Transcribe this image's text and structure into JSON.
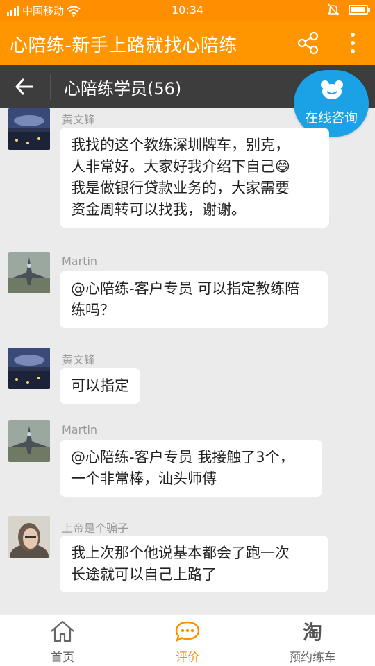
{
  "statusbar": {
    "carrier": "中国移动",
    "time": "10:34",
    "battery_level": 0.9
  },
  "titlebar": {
    "title": "心陪练-新手上路就找心陪练",
    "share_icon": "share-icon",
    "more_icon": "more-vertical-icon"
  },
  "group": {
    "title": "心陪练学员(56)",
    "back_icon": "back-arrow-icon"
  },
  "consult": {
    "label": "在线咨询",
    "icon": "bear-chat-icon",
    "color": "#1aa1e6"
  },
  "messages": [
    {
      "sender": "黄文锋",
      "avatar": "night-lake-avatar",
      "lines": [
        "我找的这个教练深圳牌车，别克，",
        "人非常好。大家好我介绍下自己😄",
        "我是做银行贷款业务的，大家需要",
        "资金周转可以找我，谢谢。"
      ]
    },
    {
      "sender": "Martin",
      "avatar": "fighter-jet-avatar",
      "lines": [
        "@心陪练-客户专员 可以指定教练陪",
        "练吗？"
      ]
    },
    {
      "sender": "黄文锋",
      "avatar": "night-lake-avatar",
      "lines": [
        "可以指定"
      ]
    },
    {
      "sender": "Martin",
      "avatar": "fighter-jet-avatar",
      "lines": [
        "@心陪练-客户专员 我接触了3个，",
        "一个非常棒，汕头师傅"
      ]
    },
    {
      "sender": "上帝是个骗子",
      "avatar": "woman-portrait-avatar",
      "lines": [
        "我上次那个他说基本都会了跑一次",
        "长途就可以自己上路了"
      ]
    }
  ],
  "nav": [
    {
      "label": "首页",
      "icon": "home-icon",
      "active": false
    },
    {
      "label": "评价",
      "icon": "chat-bubble-icon",
      "active": true
    },
    {
      "label": "预约练车",
      "icon": "taobao-icon",
      "active": false
    }
  ],
  "colors": {
    "accent": "#ff9600",
    "header_dark": "#3d3d3d"
  }
}
